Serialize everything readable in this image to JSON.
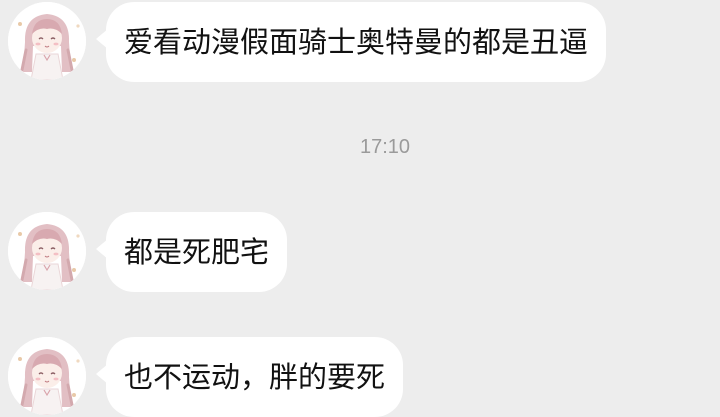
{
  "chat": {
    "messages": [
      {
        "sender": "girl-avatar",
        "text": "爱看动漫假面骑士奥特曼的都是丑逼"
      },
      {
        "sender": "girl-avatar",
        "text": "都是死肥宅"
      },
      {
        "sender": "girl-avatar",
        "text": "也不运动，胖的要死"
      }
    ],
    "timestamp": "17:10"
  },
  "colors": {
    "background": "#ededed",
    "bubble": "#ffffff",
    "text": "#111111",
    "timestamp": "#9a9a9a"
  }
}
